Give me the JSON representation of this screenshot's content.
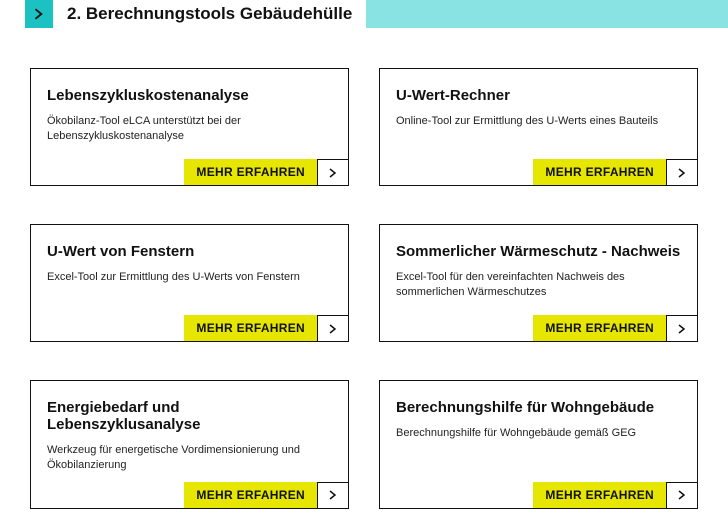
{
  "header": {
    "title": "2. Berechnungstools Gebäudehülle"
  },
  "common": {
    "learn_more": "MEHR ERFAHREN"
  },
  "cards": [
    {
      "title": "Lebenszykluskostenanalyse",
      "desc": "Ökobilanz-Tool eLCA unterstützt bei der Lebenszykluskostenanalyse"
    },
    {
      "title": "U-Wert-Rechner",
      "desc": "Online-Tool zur Ermittlung des U-Werts eines Bauteils"
    },
    {
      "title": "U-Wert von Fenstern",
      "desc": "Excel-Tool zur Ermittlung des U-Werts von Fenstern"
    },
    {
      "title": "Sommerlicher Wärmeschutz - Nachweis",
      "desc": "Excel-Tool für den vereinfachten Nachweis des sommerlichen Wärmeschutzes"
    },
    {
      "title": "Energiebedarf und Lebenszyklusanalyse",
      "desc": "Werkzeug für energetische Vordimensionierung und Ökobilanzierung"
    },
    {
      "title": "Berechnungshilfe für Wohngebäude",
      "desc": "Berechnungshilfe für Wohngebäude gemäß GEG"
    }
  ]
}
